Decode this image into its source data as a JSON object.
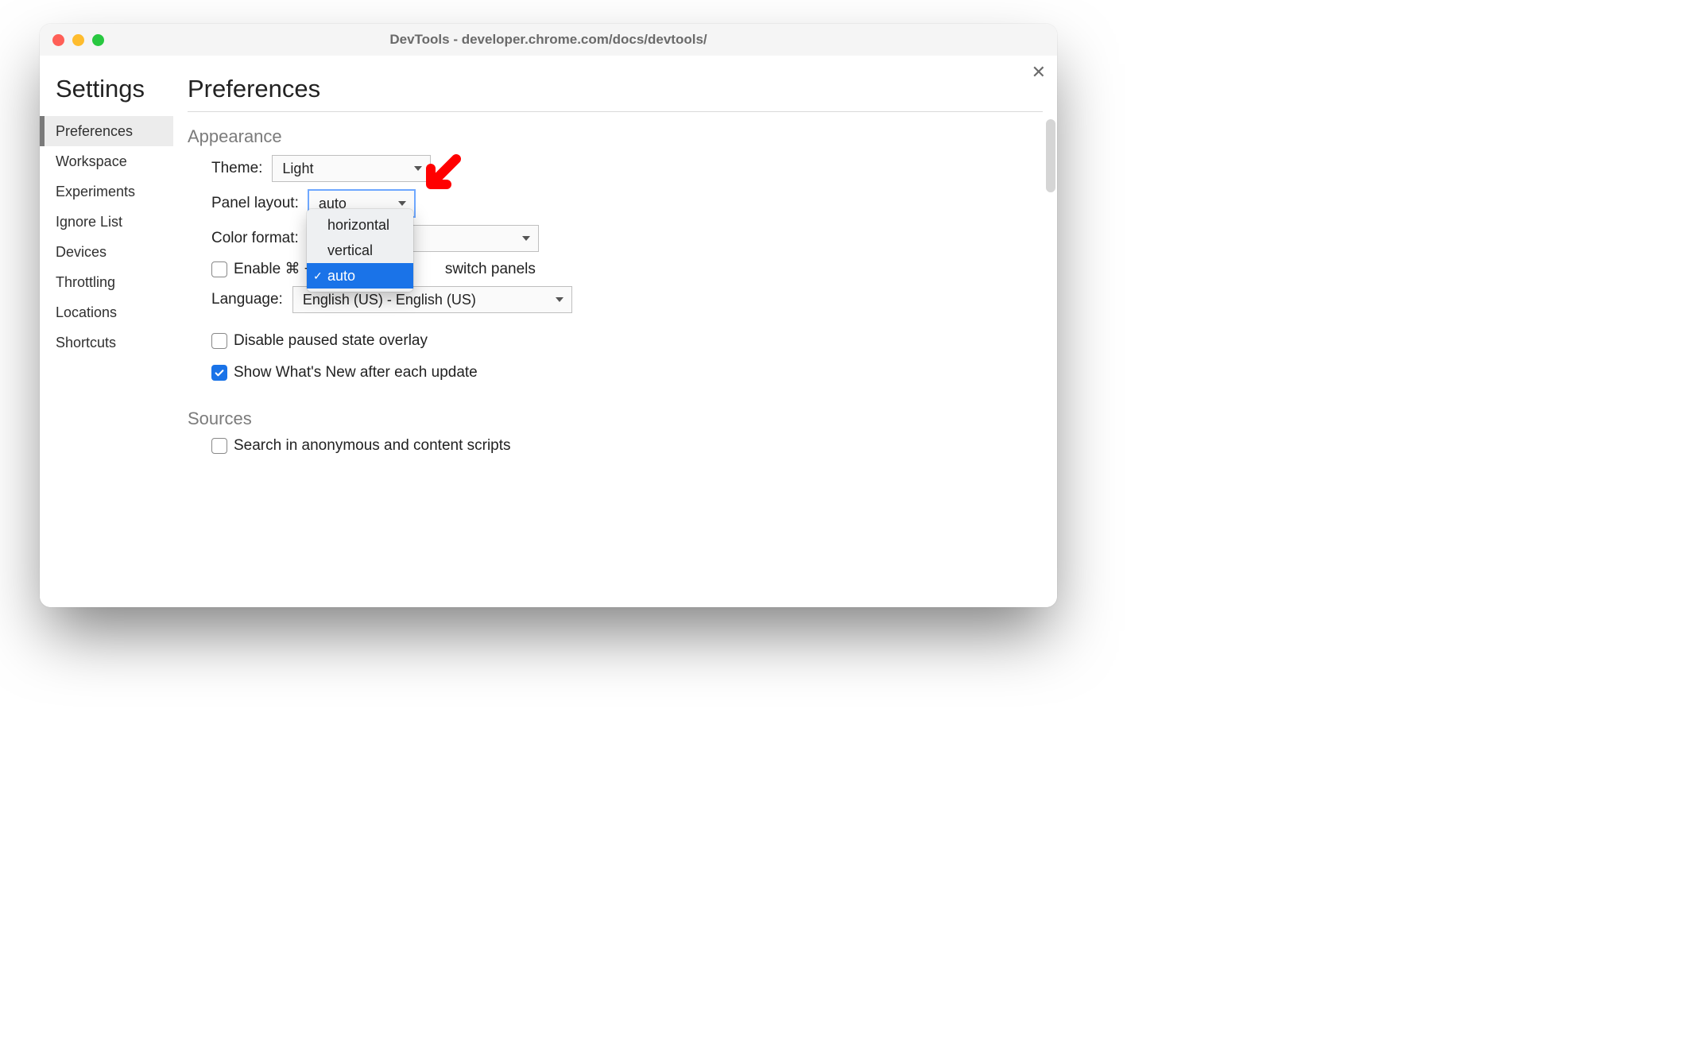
{
  "window": {
    "title": "DevTools - developer.chrome.com/docs/devtools/"
  },
  "sidebar": {
    "heading": "Settings",
    "items": [
      {
        "label": "Preferences",
        "selected": true
      },
      {
        "label": "Workspace"
      },
      {
        "label": "Experiments"
      },
      {
        "label": "Ignore List"
      },
      {
        "label": "Devices"
      },
      {
        "label": "Throttling"
      },
      {
        "label": "Locations"
      },
      {
        "label": "Shortcuts"
      }
    ]
  },
  "main": {
    "heading": "Preferences",
    "sections": {
      "appearance": {
        "title": "Appearance",
        "theme_label": "Theme:",
        "theme_value": "Light",
        "panel_label": "Panel layout:",
        "panel_value": "auto",
        "panel_options": [
          "horizontal",
          "vertical",
          "auto"
        ],
        "color_label": "Color format:",
        "color_value": "",
        "enable_shortcut_label_before": "Enable ⌘ +",
        "enable_shortcut_label_after": "switch panels",
        "enable_shortcut_checked": false,
        "language_label": "Language:",
        "language_value": "English (US) - English (US)",
        "disable_overlay_label": "Disable paused state overlay",
        "disable_overlay_checked": false,
        "whats_new_label": "Show What's New after each update",
        "whats_new_checked": true
      },
      "sources": {
        "title": "Sources",
        "search_anon_label": "Search in anonymous and content scripts",
        "search_anon_checked": false
      }
    }
  },
  "annotation": {
    "type": "red-arrow",
    "target": "panel-layout-select"
  }
}
